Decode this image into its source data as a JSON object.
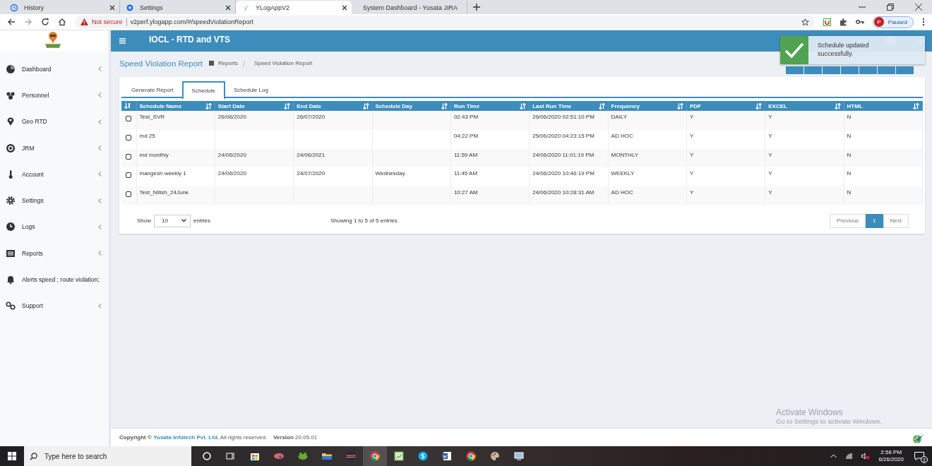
{
  "browser": {
    "tabs": [
      {
        "title": "History",
        "selected": false
      },
      {
        "title": "Settings",
        "selected": false
      },
      {
        "title": "YLogAppV2",
        "selected": true
      },
      {
        "title": "System Dashboard - Yusata JIRA",
        "selected": false
      }
    ],
    "security": "Not secure",
    "url": "v2perf.ylogapp.com/#/speedViolationReport",
    "profile_letter": "P",
    "profile_status": "Paused"
  },
  "app": {
    "title": "IOCL - RTD and VTS",
    "sidebar": {
      "items": [
        {
          "label": "Dashboard",
          "kind": "submenu"
        },
        {
          "label": "Personnel",
          "kind": "submenu"
        },
        {
          "label": "Geo RTD",
          "kind": "submenu"
        },
        {
          "label": "JRM",
          "kind": "submenu"
        },
        {
          "label": "Account",
          "kind": "submenu"
        },
        {
          "label": "Settings",
          "kind": "submenu"
        },
        {
          "label": "Logs",
          "kind": "submenu"
        },
        {
          "label": "Reports",
          "kind": "submenu"
        },
        {
          "label": "Alerts speed ; route violation;",
          "kind": "link"
        },
        {
          "label": "Support",
          "kind": "submenu"
        }
      ]
    },
    "page_title": "Speed Violation Report",
    "breadcrumb": [
      "Reports",
      "Speed Violation Report"
    ],
    "tabs": [
      {
        "label": "Generate Report",
        "selected": false
      },
      {
        "label": "Schedule",
        "selected": true
      },
      {
        "label": "Schedule Log",
        "selected": false
      }
    ],
    "table": {
      "columns": [
        "Schedule Name",
        "Start Date",
        "End Date",
        "Schedule Day",
        "Run Time",
        "Last Run Time",
        "Frequency",
        "PDF",
        "EXCEL",
        "HTML"
      ],
      "rows": [
        {
          "checked": false,
          "cells": [
            "Test_SVR",
            "26/06/2020",
            "26/07/2020",
            "",
            "02:43 PM",
            "26/06/2020 02:51:10 PM",
            "DAILY",
            "Y",
            "Y",
            "N"
          ]
        },
        {
          "checked": false,
          "cells": [
            "md 25",
            "",
            "",
            "",
            "04:22 PM",
            "25/06/2020 04:23:15 PM",
            "AD HOC",
            "Y",
            "Y",
            "N"
          ]
        },
        {
          "checked": false,
          "cells": [
            "md monthly",
            "24/06/2020",
            "24/06/2021",
            "",
            "11:59 AM",
            "24/06/2020 11:01:19 PM",
            "MONTHLY",
            "Y",
            "Y",
            "N"
          ]
        },
        {
          "checked": false,
          "cells": [
            "mangesh weekly 1",
            "24/06/2020",
            "24/07/2020",
            "Wednesday",
            "11:45 AM",
            "24/06/2020 10:46:19 PM",
            "WEEKLY",
            "Y",
            "Y",
            "N"
          ]
        },
        {
          "checked": false,
          "cells": [
            "Test_Nitish_24June",
            "",
            "",
            "",
            "10:27 AM",
            "24/06/2020 10:28:31 AM",
            "AD HOC",
            "Y",
            "Y",
            "N"
          ]
        }
      ]
    },
    "length_label": "Show",
    "length_value": "10",
    "length_suffix": "entries",
    "info": "Showing 1 to 5 of 5 entries",
    "pagination": [
      {
        "label": "Previous",
        "selected": false
      },
      {
        "label": "1",
        "selected": true
      },
      {
        "label": "Next",
        "selected": false
      }
    ],
    "footer": {
      "copyright": "**Copyright ©**",
      "company": "Yusata Infotech Pvt. Ltd.",
      "rights": "All rights reserved.",
      "version": "**Version** 20.05.01"
    },
    "toast": {
      "message": "Schedule updated successfully."
    }
  },
  "watermark": {
    "title": "Activate Windows",
    "subtitle": "Go to Settings to activate Windows."
  },
  "taskbar": {
    "search_placeholder": "Type here to search",
    "time": "2:56 PM",
    "date": "6/26/2020",
    "notifications": "2"
  }
}
